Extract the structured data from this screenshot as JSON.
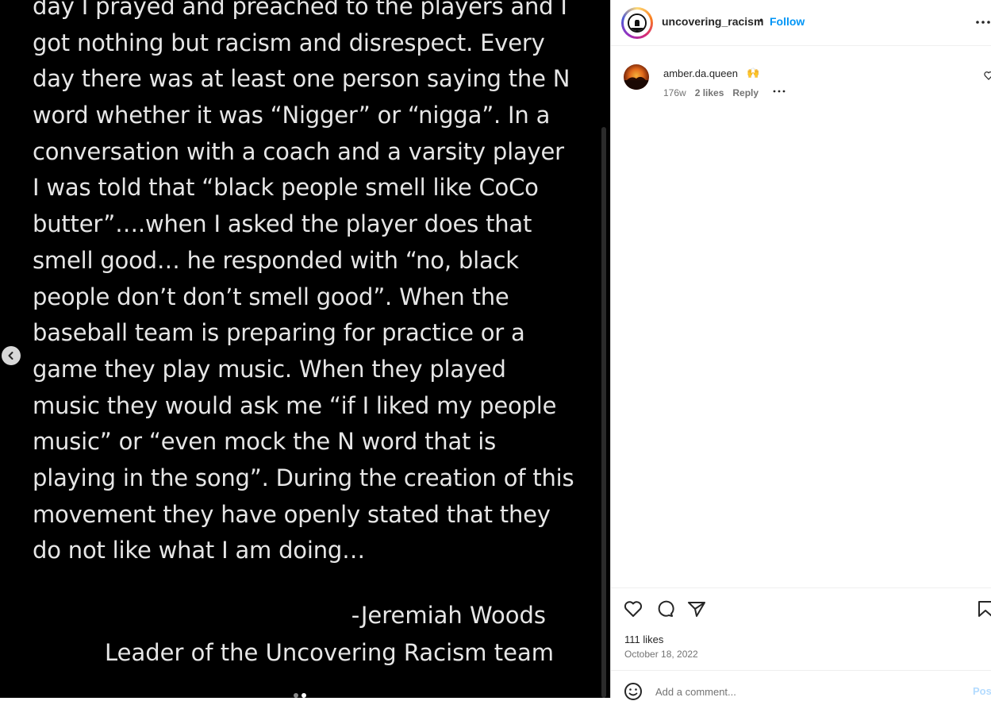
{
  "media": {
    "text_lines": [
      "day I prayed and preached to the players and I",
      "got nothing but racism and disrespect. Every",
      "day there was at least one person saying the N",
      "word whether it was “Nigger” or “nigga”. In a",
      "conversation with a coach and a varsity player",
      "I was told that “black people smell like CoCo",
      "butter”….when I asked the player does that",
      "smell good… he responded with “no, black",
      "people don’t don’t smell good”. When the",
      "baseball team is preparing for practice or a",
      "game they play music. When they played",
      "music they would ask me “if I liked my people",
      "music” or “even mock the N word that is",
      "playing in the song”. During the creation of this",
      "movement they have openly stated that they",
      "do not like what I am doing…"
    ],
    "signature_name": "-Jeremiah Woods",
    "signature_role": "Leader of the Uncovering Racism team"
  },
  "header": {
    "username": "uncovering_racism",
    "separator": "•",
    "follow_label": "Follow"
  },
  "comment": {
    "author": "amber.da.queen",
    "emoji": "🙌",
    "age": "176w",
    "likes": "2 likes",
    "reply_label": "Reply"
  },
  "footer": {
    "likes": "111 likes",
    "date": "October 18, 2022",
    "add_comment_placeholder": "Add a comment...",
    "post_label": "Post"
  },
  "colors": {
    "accent": "#0095f6",
    "post_disabled": "#b3dbff",
    "media_bg": "#000000"
  },
  "icons": [
    "chevron-left-icon",
    "more-icon",
    "heart-icon",
    "comment-icon",
    "share-icon",
    "bookmark-icon",
    "emoji-icon"
  ]
}
